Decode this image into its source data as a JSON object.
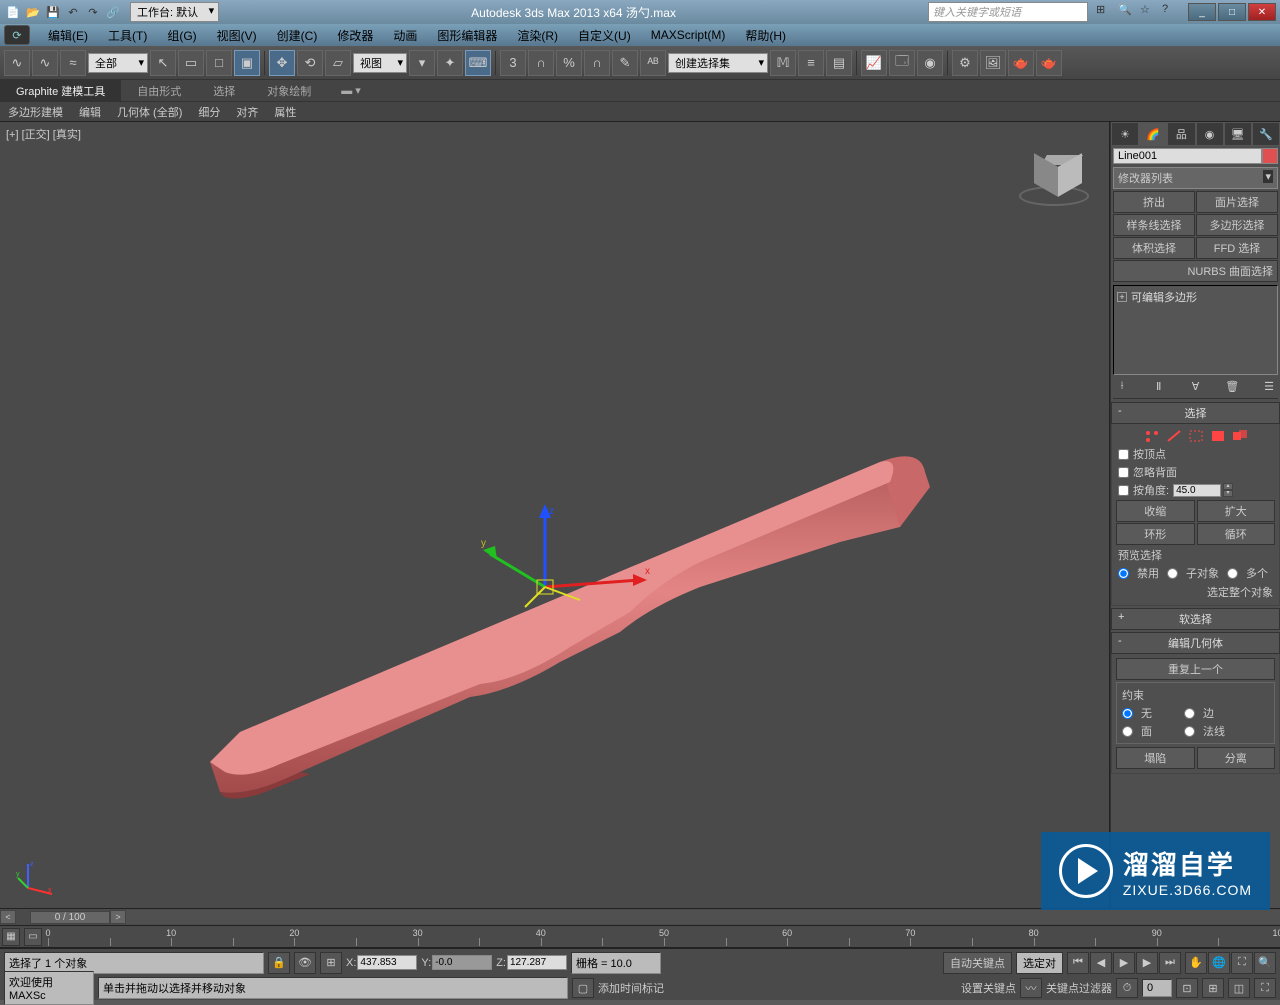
{
  "titlebar": {
    "workspace_label": "工作台: 默认",
    "app_title": "Autodesk 3ds Max  2013 x64      汤勺.max",
    "search_placeholder": "键入关键字或短语"
  },
  "menus": [
    "编辑(E)",
    "工具(T)",
    "组(G)",
    "视图(V)",
    "创建(C)",
    "修改器",
    "动画",
    "图形编辑器",
    "渲染(R)",
    "自定义(U)",
    "MAXScript(M)",
    "帮助(H)"
  ],
  "main_toolbar": {
    "filter_dd": "全部",
    "view_dd": "视图",
    "sel_set_dd": "创建选择集"
  },
  "ribbon": {
    "tabs": [
      "Graphite 建模工具",
      "自由形式",
      "选择",
      "对象绘制"
    ],
    "sub": [
      "多边形建模",
      "编辑",
      "几何体 (全部)",
      "细分",
      "对齐",
      "属性"
    ]
  },
  "viewport": {
    "label": "[+] [正交] [真实]"
  },
  "cmdpanel": {
    "obj_name": "Line001",
    "modlist_label": "修改器列表",
    "mod_buttons": [
      "挤出",
      "面片选择",
      "样条线选择",
      "多边形选择",
      "体积选择",
      "FFD 选择",
      "NURBS 曲面选择"
    ],
    "stack_node": "可编辑多边形",
    "rollout_sel": {
      "title": "选择",
      "by_vertex": "按顶点",
      "ignore_back": "忽略背面",
      "by_angle": "按角度:",
      "angle_val": "45.0",
      "shrink": "收缩",
      "grow": "扩大",
      "ring": "环形",
      "loop": "循环",
      "preview": "预览选择",
      "disable": "禁用",
      "subobj": "子对象",
      "multi": "多个",
      "whole": "选定整个对象"
    },
    "rollout_soft": "软选择",
    "rollout_editgeo": {
      "title": "编辑几何体",
      "repeat": "重复上一个",
      "constraint": "约束",
      "none": "无",
      "edge": "边",
      "face": "面",
      "normal": "法线",
      "collapse": "塌陷",
      "split": "分离"
    }
  },
  "timeline": {
    "frame": "0 / 100"
  },
  "status": {
    "sel": "选择了 1 个对象",
    "x": "437.853",
    "y": "-0.0",
    "z": "127.287",
    "grid": "栅格 = 10.0",
    "autokey": "自动关键点",
    "selkey": "选定对"
  },
  "bottom": {
    "welcome": "欢迎使用  MAXSc",
    "hint": "单击并拖动以选择并移动对象",
    "addmarker": "添加时间标记",
    "setkey": "设置关键点",
    "keyfilter": "关键点过滤器"
  },
  "watermark": {
    "l1": "溜溜自学",
    "l2": "ZIXUE.3D66.COM"
  }
}
